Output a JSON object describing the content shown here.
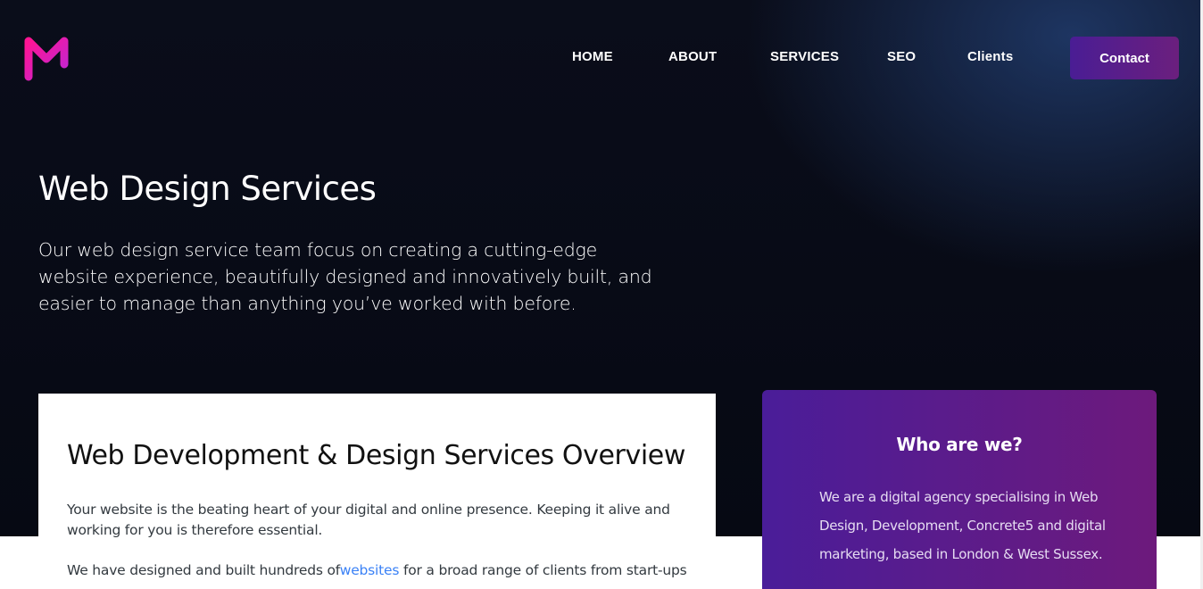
{
  "brand": {
    "logo_color_a": "#ff1493",
    "logo_color_b": "#c026d3"
  },
  "nav": {
    "items": [
      {
        "label": "HOME"
      },
      {
        "label": "ABOUT"
      },
      {
        "label": "SERVICES"
      },
      {
        "label": "SEO"
      },
      {
        "label": "Clients"
      }
    ],
    "contact_label": "Contact"
  },
  "hero": {
    "title": "Web Design Services",
    "text": "Our web design service team focus on creating a cutting-edge website experience, beautifully designed and innovatively built, and easier to manage than anything you’ve worked with before."
  },
  "overview": {
    "title": "Web Development & Design Services Overview",
    "paragraph1": "Your website is the beating heart of your digital and online presence. Keeping it alive and working for you is therefore essential.",
    "paragraph2_before": "We have designed and built hundreds of",
    "paragraph2_link": "websites",
    "paragraph2_after": " for a broad range of clients from start-ups"
  },
  "sidebar": {
    "title": "Who are we?",
    "text": "We are a digital agency specialising in Web Design, Development, Concrete5 and digital marketing, based in London & West Sussex."
  },
  "colors": {
    "hero_bg": "#080b17",
    "accent_purple": "#4a1d99",
    "accent_magenta": "#6d1a7c",
    "link_blue": "#3b82f6"
  }
}
